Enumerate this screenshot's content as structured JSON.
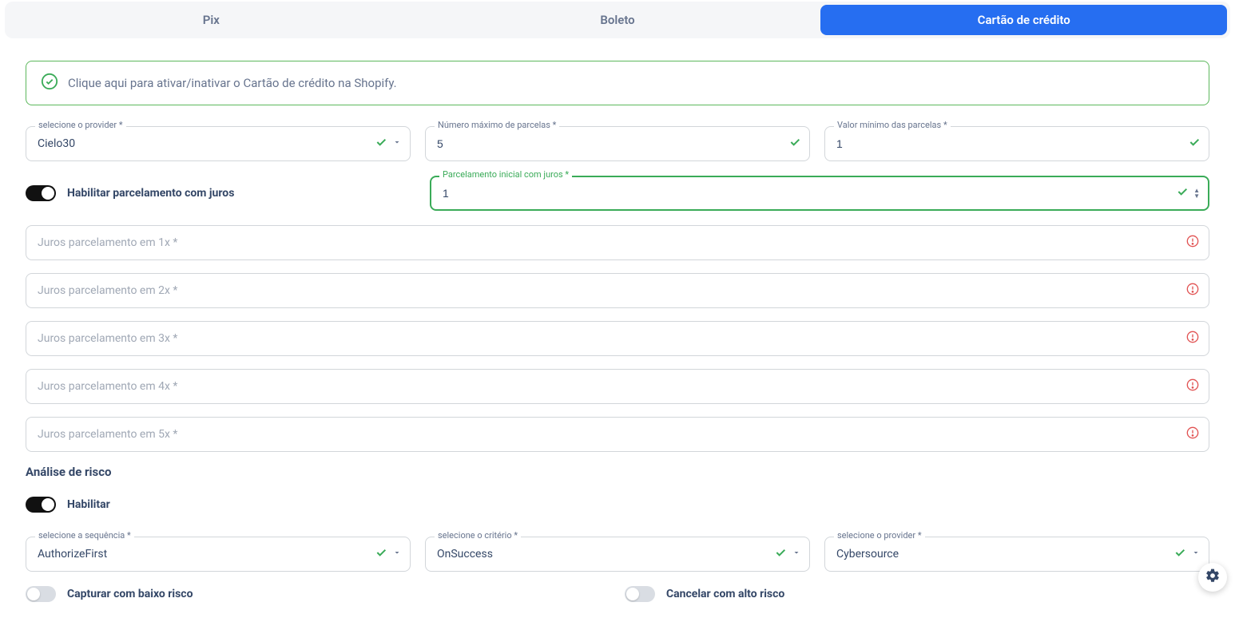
{
  "tabs": {
    "pix": "Pix",
    "boleto": "Boleto",
    "credit": "Cartão de crédito"
  },
  "alert": {
    "text": "Clique aqui para ativar/inativar o Cartão de crédito na Shopify."
  },
  "fields": {
    "provider": {
      "label": "selecione o provider *",
      "value": "Cielo30"
    },
    "max_parcelas": {
      "label": "Número máximo de parcelas *",
      "value": "5"
    },
    "valor_min": {
      "label": "Valor mínimo das parcelas *",
      "value": "1"
    },
    "habilitar_juros": "Habilitar parcelamento com juros",
    "parc_inicial": {
      "label": "Parcelamento inicial com juros *",
      "value": "1"
    }
  },
  "juros_rows": [
    "Juros parcelamento em 1x *",
    "Juros parcelamento em 2x *",
    "Juros parcelamento em 3x *",
    "Juros parcelamento em 4x *",
    "Juros parcelamento em 5x *"
  ],
  "risk": {
    "title": "Análise de risco",
    "habilitar": "Habilitar",
    "sequencia": {
      "label": "selecione a sequência *",
      "value": "AuthorizeFirst"
    },
    "criterio": {
      "label": "selecione o critério *",
      "value": "OnSuccess"
    },
    "provider": {
      "label": "selecione o provider *",
      "value": "Cybersource"
    },
    "capturar": "Capturar com baixo risco",
    "cancelar": "Cancelar com alto risco"
  }
}
